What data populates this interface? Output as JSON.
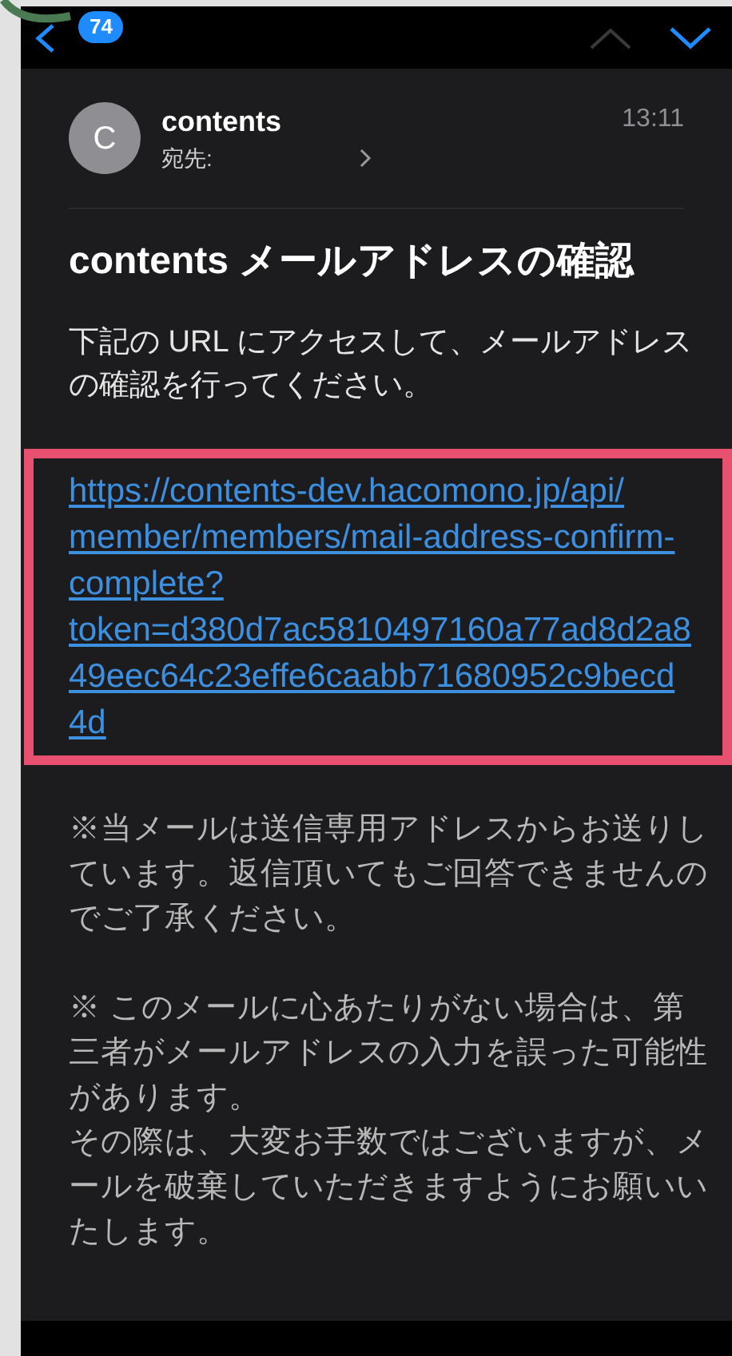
{
  "nav": {
    "unread_badge": "74"
  },
  "header": {
    "avatar_initial": "C",
    "sender": "contents",
    "to_label": "宛先:",
    "time": "13:11"
  },
  "subject": "contents メールアドレスの確認",
  "intro": "下記の URL にアクセスして、メールアドレスの確認を行ってください。",
  "link_lines": [
    "https://contents-dev.hacomono.jp/api/",
    "member/members/mail-address-confirm-",
    "complete?",
    "token=d380d7ac5810497160a77ad8d2a8",
    "49eec64c23effe6caabb71680952c9becd",
    "4d"
  ],
  "notes": [
    [
      "※当メールは送信専用アドレスからお送りしています。返信頂いてもご回答できませんのでご了承ください。"
    ],
    [
      "※ このメールに心あたりがない場合は、第三者がメールアドレスの入力を誤った可能性があります。",
      "その際は、大変お手数ではございますが、メールを破棄していただきますようにお願いいたします。"
    ]
  ]
}
